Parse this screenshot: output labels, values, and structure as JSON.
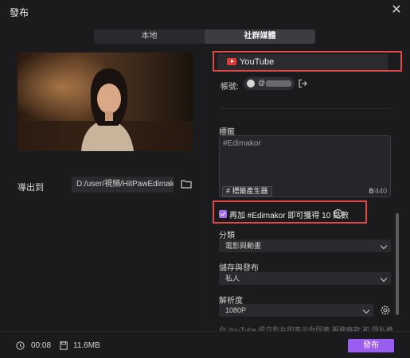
{
  "window": {
    "title": "發布"
  },
  "tabs": [
    {
      "label": "本地",
      "active": false
    },
    {
      "label": "社群媒體",
      "active": true
    }
  ],
  "export": {
    "label": "導出到",
    "path": "D:/user/視頻/HitPawEdimakor"
  },
  "platform": {
    "name": "YouTube",
    "brand_color": "#e53935"
  },
  "account": {
    "label": "帳號:",
    "name": "@"
  },
  "tags": {
    "label": "標籤",
    "value": "#Edimakor",
    "generator_label": "標籤產生器",
    "count_current": "8",
    "count_max": "/440"
  },
  "promo": {
    "checked": true,
    "text": "再加 #Edimakor 即可獲得 10 點數"
  },
  "category": {
    "label": "分類",
    "value": "電影與動畫"
  },
  "privacy": {
    "label": "儲存與發布",
    "value": "私人"
  },
  "resolution": {
    "label": "解析度",
    "value": "1080P"
  },
  "notice": {
    "text": "向 YouTube 提交影片即表示你同意 服務條款 和 隱私權政"
  },
  "footer": {
    "duration": "00:08",
    "filesize": "11.6MB",
    "publish_label": "發布"
  },
  "colors": {
    "accent": "#9b5cf0",
    "highlight": "#e04848",
    "background": "#1b1b1e"
  }
}
